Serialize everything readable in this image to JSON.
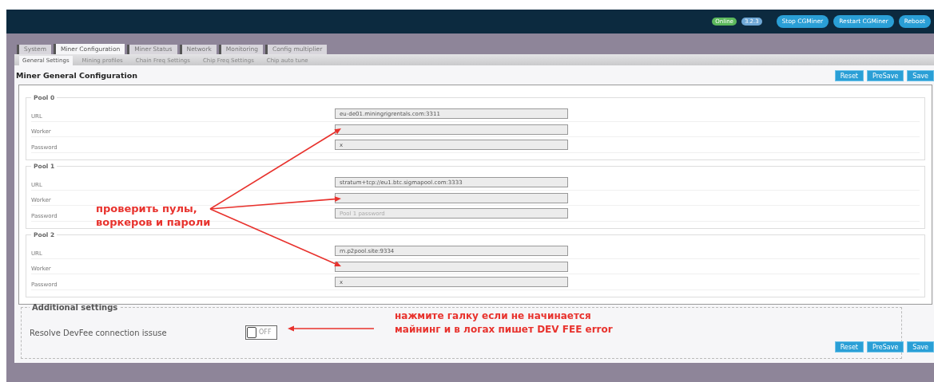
{
  "header": {
    "badges": [
      {
        "text": "Online",
        "color": "#5cb85c"
      },
      {
        "text": "3.2.3",
        "color": "#6fa8d6"
      }
    ],
    "buttons": [
      "Stop CGMiner",
      "Restart CGMiner",
      "Reboot"
    ]
  },
  "tabs": [
    {
      "label": "System",
      "selected": false
    },
    {
      "label": "Miner Configuration",
      "selected": true
    },
    {
      "label": "Miner Status",
      "selected": false
    },
    {
      "label": "Network",
      "selected": false
    },
    {
      "label": "Monitoring",
      "selected": false
    },
    {
      "label": "Config multiplier",
      "selected": false
    }
  ],
  "subtabs": [
    {
      "label": "General Settings",
      "selected": true
    },
    {
      "label": "Mining profiles",
      "selected": false
    },
    {
      "label": "Chain Freq Settings",
      "selected": false
    },
    {
      "label": "Chip Freq Settings",
      "selected": false
    },
    {
      "label": "Chip auto tune",
      "selected": false
    }
  ],
  "section": {
    "title": "Miner General Configuration",
    "actions": [
      "Reset",
      "PreSave",
      "Save"
    ]
  },
  "pools": [
    {
      "legend": "Pool 0",
      "fields": [
        {
          "label": "URL",
          "value": "eu-de01.miningrigrentals.com:3311"
        },
        {
          "label": "Worker"
        },
        {
          "label": "Password",
          "value": "x"
        }
      ]
    },
    {
      "legend": "Pool 1",
      "fields": [
        {
          "label": "URL",
          "value": "stratum+tcp://eu1.btc.sigmapool.com:3333"
        },
        {
          "label": "Worker"
        },
        {
          "label": "Password",
          "placeholder": "Pool 1 password"
        }
      ]
    },
    {
      "legend": "Pool 2",
      "fields": [
        {
          "label": "URL",
          "value": "rn.p2pool.site:9334"
        },
        {
          "label": "Worker"
        },
        {
          "label": "Password",
          "value": "x"
        }
      ]
    }
  ],
  "additional": {
    "legend": "Additional settings",
    "options": [
      {
        "label": "Resolve DevFee connection issuse",
        "on": false,
        "toggle_text": "OFF"
      }
    ]
  },
  "footer_actions": [
    "Reset",
    "PreSave",
    "Save"
  ],
  "annotations": [
    {
      "text": "проверить пулы,\nворкеров и пароли"
    },
    {
      "text": "нажмите галку если не начинается\nмайнинг и в логах пишет DEV FEE error"
    }
  ]
}
